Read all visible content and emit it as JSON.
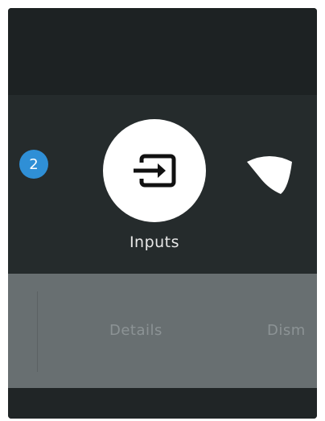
{
  "notifications": {
    "badge_count": "2"
  },
  "quick_settings": {
    "inputs_icon": "input-source-icon",
    "inputs_label": "Inputs",
    "network_icon": "wifi-icon"
  },
  "actions": {
    "details_label": "Details",
    "dismiss_label": "Dism"
  },
  "colors": {
    "background": "#252b2c",
    "badge": "#2f8fd6",
    "action_bar": "#686f71"
  }
}
